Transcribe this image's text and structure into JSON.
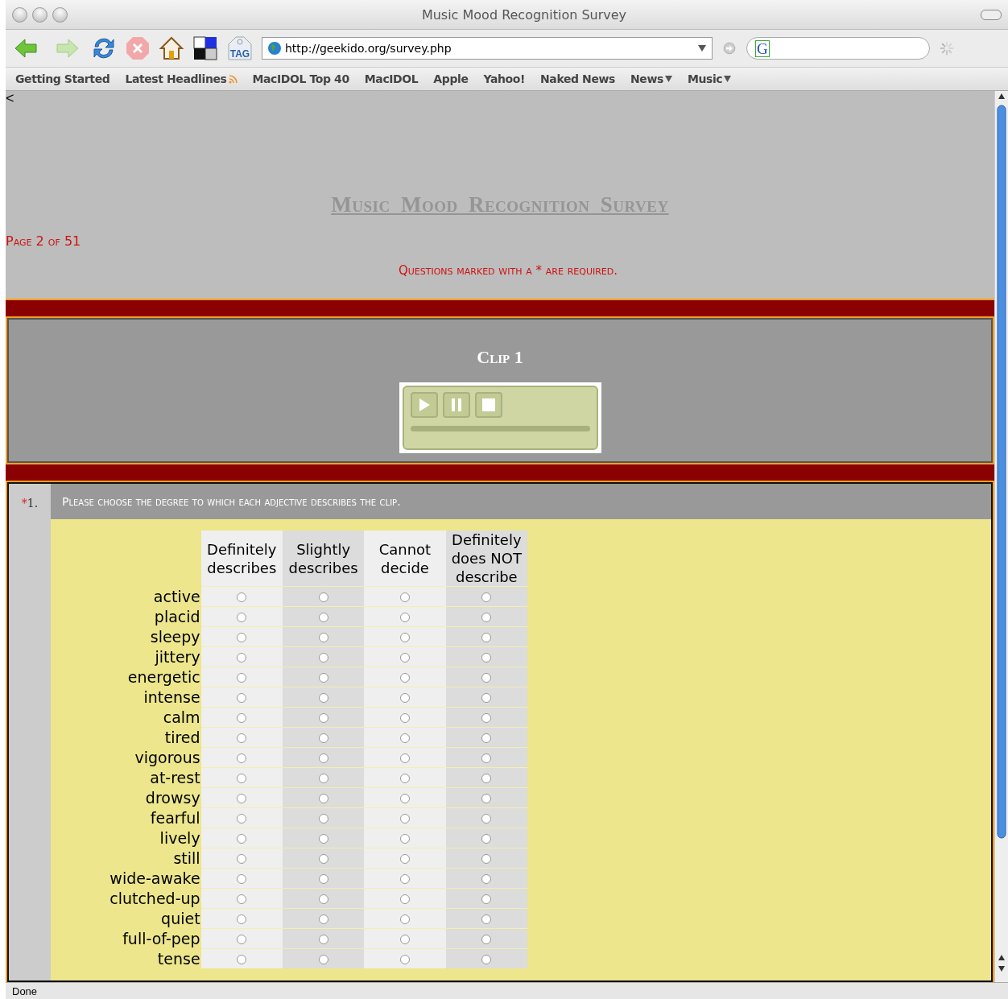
{
  "window": {
    "title": "Music Mood Recognition Survey"
  },
  "toolbar": {
    "tag_label": "TAG",
    "url": "http://geekido.org/survey.php",
    "search_engine_letter": "G"
  },
  "bookmarks": [
    {
      "label": "Getting Started",
      "feed": false,
      "menu": false
    },
    {
      "label": "Latest Headlines",
      "feed": true,
      "menu": false
    },
    {
      "label": "MacIDOL Top 40",
      "feed": false,
      "menu": false
    },
    {
      "label": "MacIDOL",
      "feed": false,
      "menu": false
    },
    {
      "label": "Apple",
      "feed": false,
      "menu": false
    },
    {
      "label": "Yahoo!",
      "feed": false,
      "menu": false
    },
    {
      "label": "Naked News",
      "feed": false,
      "menu": false
    },
    {
      "label": "News",
      "feed": false,
      "menu": true
    },
    {
      "label": "Music",
      "feed": false,
      "menu": true
    }
  ],
  "page": {
    "back_mark": "<",
    "title": "Music Mood Recognition Survey",
    "page_indicator": "Page 2 of 51",
    "required_note": "Questions marked with a * are required."
  },
  "clip": {
    "title": "Clip 1"
  },
  "question": {
    "required_mark": "*",
    "number": "1.",
    "prompt": "Please choose the degree to which each adjective describes the clip.",
    "columns": [
      "Definitely describes",
      "Slightly describes",
      "Cannot decide",
      "Definitely does NOT describe"
    ],
    "rows": [
      {
        "label": "active",
        "choices": [
          {
            "selected": false
          },
          {
            "selected": false
          },
          {
            "selected": false
          },
          {
            "selected": false
          }
        ]
      },
      {
        "label": "placid",
        "choices": [
          {
            "selected": false
          },
          {
            "selected": false
          },
          {
            "selected": false
          },
          {
            "selected": false
          }
        ]
      },
      {
        "label": "sleepy",
        "choices": [
          {
            "selected": false
          },
          {
            "selected": false
          },
          {
            "selected": false
          },
          {
            "selected": false
          }
        ]
      },
      {
        "label": "jittery",
        "choices": [
          {
            "selected": false
          },
          {
            "selected": false
          },
          {
            "selected": false
          },
          {
            "selected": false
          }
        ]
      },
      {
        "label": "energetic",
        "choices": [
          {
            "selected": false
          },
          {
            "selected": false
          },
          {
            "selected": false
          },
          {
            "selected": false
          }
        ]
      },
      {
        "label": "intense",
        "choices": [
          {
            "selected": false
          },
          {
            "selected": false
          },
          {
            "selected": false
          },
          {
            "selected": false
          }
        ]
      },
      {
        "label": "calm",
        "choices": [
          {
            "selected": false
          },
          {
            "selected": false
          },
          {
            "selected": false
          },
          {
            "selected": false
          }
        ]
      },
      {
        "label": "tired",
        "choices": [
          {
            "selected": false
          },
          {
            "selected": false
          },
          {
            "selected": false
          },
          {
            "selected": false
          }
        ]
      },
      {
        "label": "vigorous",
        "choices": [
          {
            "selected": false
          },
          {
            "selected": false
          },
          {
            "selected": false
          },
          {
            "selected": false
          }
        ]
      },
      {
        "label": "at-rest",
        "choices": [
          {
            "selected": false
          },
          {
            "selected": false
          },
          {
            "selected": false
          },
          {
            "selected": false
          }
        ]
      },
      {
        "label": "drowsy",
        "choices": [
          {
            "selected": false
          },
          {
            "selected": false
          },
          {
            "selected": false
          },
          {
            "selected": false
          }
        ]
      },
      {
        "label": "fearful",
        "choices": [
          {
            "selected": false
          },
          {
            "selected": false
          },
          {
            "selected": false
          },
          {
            "selected": false
          }
        ]
      },
      {
        "label": "lively",
        "choices": [
          {
            "selected": false
          },
          {
            "selected": false
          },
          {
            "selected": false
          },
          {
            "selected": false
          }
        ]
      },
      {
        "label": "still",
        "choices": [
          {
            "selected": false
          },
          {
            "selected": false
          },
          {
            "selected": false
          },
          {
            "selected": false
          }
        ]
      },
      {
        "label": "wide-awake",
        "choices": [
          {
            "selected": false
          },
          {
            "selected": false
          },
          {
            "selected": false
          },
          {
            "selected": false
          }
        ]
      },
      {
        "label": "clutched-up",
        "choices": [
          {
            "selected": false
          },
          {
            "selected": false
          },
          {
            "selected": false
          },
          {
            "selected": false
          }
        ]
      },
      {
        "label": "quiet",
        "choices": [
          {
            "selected": false
          },
          {
            "selected": false
          },
          {
            "selected": false
          },
          {
            "selected": false
          }
        ]
      },
      {
        "label": "full-of-pep",
        "choices": [
          {
            "selected": false
          },
          {
            "selected": false
          },
          {
            "selected": false
          },
          {
            "selected": false
          }
        ]
      },
      {
        "label": "tense",
        "choices": [
          {
            "selected": false
          },
          {
            "selected": false
          },
          {
            "selected": false
          },
          {
            "selected": false
          }
        ]
      }
    ]
  },
  "status_bar": {
    "text": "Done"
  }
}
